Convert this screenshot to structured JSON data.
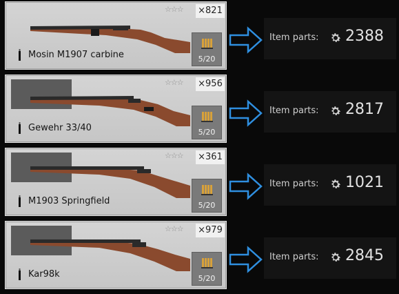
{
  "rows": [
    {
      "name": "Mosin M1907 carbine",
      "count": "×821",
      "stars": "☆☆☆",
      "ammo": "5/20",
      "has_dark_square": false,
      "parts_label": "Item parts:",
      "parts_value": "2388"
    },
    {
      "name": "Gewehr 33/40",
      "count": "×956",
      "stars": "☆☆☆",
      "ammo": "5/20",
      "has_dark_square": true,
      "parts_label": "Item parts:",
      "parts_value": "2817"
    },
    {
      "name": "M1903 Springfield",
      "count": "×361",
      "stars": "☆☆☆",
      "ammo": "5/20",
      "has_dark_square": true,
      "parts_label": "Item parts:",
      "parts_value": "1021"
    },
    {
      "name": "Kar98k",
      "count": "×979",
      "stars": "☆☆☆",
      "ammo": "5/20",
      "has_dark_square": true,
      "parts_label": "Item parts:",
      "parts_value": "2845"
    }
  ],
  "colors": {
    "arrow": "#2f8fe0",
    "wood": "#8a4a2e",
    "metal": "#2a2a2a",
    "brass": "#d8a13a"
  },
  "icons": {
    "parts": "gear-icon",
    "arrow": "arrow-right-icon",
    "ammo": "cartridges-icon",
    "type": "bullet-icon"
  }
}
